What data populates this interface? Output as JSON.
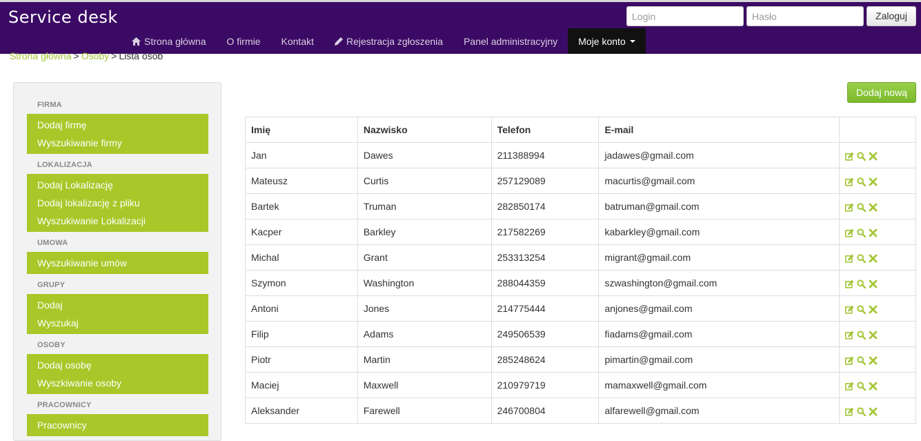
{
  "app": {
    "brand": "Service desk",
    "login_placeholder": "Login",
    "password_placeholder": "Hasło",
    "login_button": "Zaloguj"
  },
  "nav": [
    {
      "label": "Strona główna",
      "icon": "home-icon"
    },
    {
      "label": "O firmie"
    },
    {
      "label": "Kontakt"
    },
    {
      "label": "Rejestracja zgłoszenia",
      "icon": "pencil-icon"
    },
    {
      "label": "Panel administracyjny"
    },
    {
      "label": "Moje konto",
      "dropdown": true
    }
  ],
  "breadcrumb": {
    "home": "Strona główna",
    "section": "Osoby",
    "current": "Lista osób",
    "separator": ">"
  },
  "sidebar": {
    "sections": [
      {
        "header": "FIRMA",
        "items": [
          "Dodaj firmę",
          "Wyszukiwanie firmy"
        ]
      },
      {
        "header": "LOKALIZACJA",
        "items": [
          "Dodaj Lokalizację",
          "Dodaj lokalizację z pliku",
          "Wyszukiwanie Lokalizacji"
        ]
      },
      {
        "header": "UMOWA",
        "items": [
          "Wyszukiwanie umów"
        ]
      },
      {
        "header": "GRUPY",
        "items": [
          "Dodaj",
          "Wyszukaj"
        ]
      },
      {
        "header": "OSOBY",
        "items": [
          "Dodaj osobę",
          "Wyszkiwanie osoby"
        ]
      },
      {
        "header": "PRACOWNICY",
        "items": [
          "Pracownicy"
        ]
      }
    ]
  },
  "main": {
    "add_button": "Dodaj nową",
    "table": {
      "columns": [
        "Imię",
        "Nazwisko",
        "Telefon",
        "E-mail",
        ""
      ],
      "rows": [
        [
          "Jan",
          "Dawes",
          "211388994",
          "jadawes@gmail.com"
        ],
        [
          "Mateusz",
          "Curtis",
          "257129089",
          "macurtis@gmail.com"
        ],
        [
          "Bartek",
          "Truman",
          "282850174",
          "batruman@gmail.com"
        ],
        [
          "Kacper",
          "Barkley",
          "217582269",
          "kabarkley@gmail.com"
        ],
        [
          "Michal",
          "Grant",
          "253313254",
          "migrant@gmail.com"
        ],
        [
          "Szymon",
          "Washington",
          "288044359",
          "szwashington@gmail.com"
        ],
        [
          "Antoni",
          "Jones",
          "214775444",
          "anjones@gmail.com"
        ],
        [
          "Filip",
          "Adams",
          "249506539",
          "fiadams@gmail.com"
        ],
        [
          "Piotr",
          "Martin",
          "285248624",
          "pimartin@gmail.com"
        ],
        [
          "Maciej",
          "Maxwell",
          "210979719",
          "mamaxwell@gmail.com"
        ],
        [
          "Aleksander",
          "Farewell",
          "246700804",
          "alfarewell@gmail.com"
        ]
      ],
      "row_actions": [
        "edit-icon",
        "search-icon",
        "delete-icon"
      ]
    }
  },
  "colors": {
    "navbar": "#3b0a64",
    "accent_green": "#a9c728",
    "button_green": "#8cc63f",
    "link_green": "#a4c639",
    "nav_active": "#111111"
  }
}
